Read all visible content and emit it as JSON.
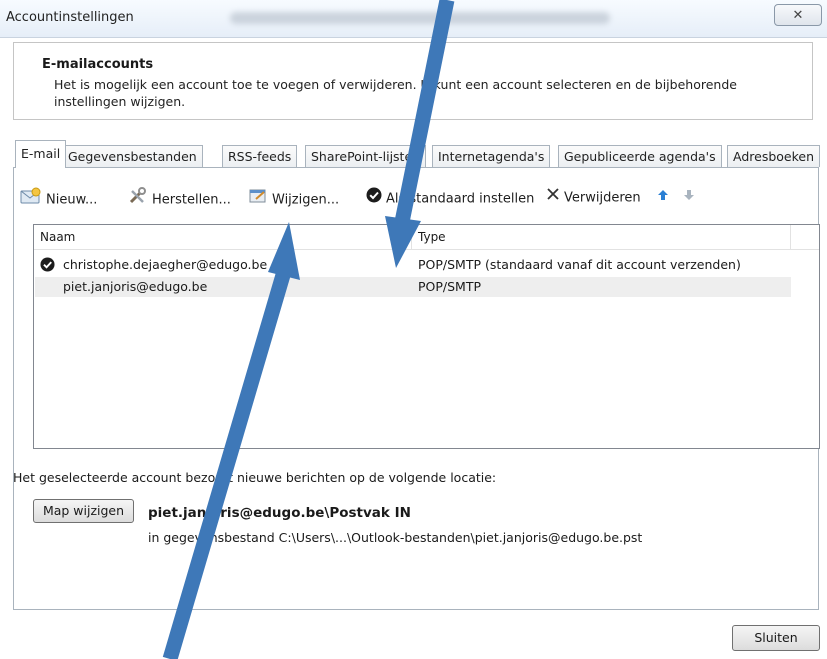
{
  "window": {
    "title": "Accountinstellingen",
    "close_glyph": "✕"
  },
  "header": {
    "title": "E-mailaccounts",
    "description": "Het is mogelijk een account toe te voegen of verwijderen. U kunt een account selecteren en de bijbehorende instellingen wijzigen."
  },
  "tabs": [
    {
      "label": "E-mail"
    },
    {
      "label": "Gegevensbestanden"
    },
    {
      "label": "RSS-feeds"
    },
    {
      "label": "SharePoint-lijsten"
    },
    {
      "label": "Internetagenda's"
    },
    {
      "label": "Gepubliceerde agenda's"
    },
    {
      "label": "Adresboeken"
    }
  ],
  "toolbar": {
    "new_label": "Nieuw...",
    "repair_label": "Herstellen...",
    "change_label": "Wijzigen...",
    "default_label": "Als standaard instellen",
    "remove_label": "Verwijderen"
  },
  "list": {
    "col_name": "Naam",
    "col_type": "Type",
    "rows": [
      {
        "name": "christophe.dejaegher@edugo.be",
        "type": "POP/SMTP (standaard vanaf dit account verzenden)"
      },
      {
        "name": "piet.janjoris@edugo.be",
        "type": "POP/SMTP"
      }
    ]
  },
  "location": {
    "label": "Het geselecteerde account bezorgt nieuwe berichten op de volgende locatie:",
    "change_folder_button": "Map wijzigen",
    "path": "piet.janjoris@edugo.be\\Postvak IN",
    "file": "in gegevensbestand C:\\Users\\...\\Outlook-bestanden\\piet.janjoris@edugo.be.pst"
  },
  "footer": {
    "close_button": "Sluiten"
  },
  "colors": {
    "arrow": "#3e78b8",
    "accent_up": "#2a7fd4"
  },
  "icons": [
    "mail-new-icon",
    "repair-tools-icon",
    "change-icon",
    "checkmark-icon",
    "delete-x-icon",
    "move-up-icon",
    "move-down-icon"
  ]
}
